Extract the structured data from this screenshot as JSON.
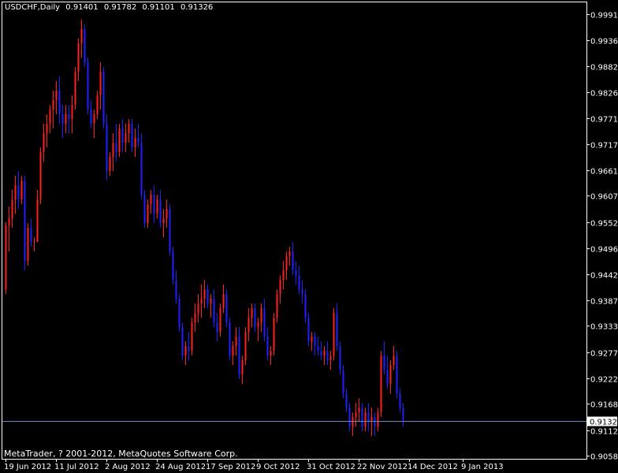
{
  "header": {
    "symbol": "USDCHF,Daily",
    "open": "0.91401",
    "high": "0.91782",
    "low": "0.91101",
    "close": "0.91326"
  },
  "footer": {
    "copyright": "MetaTrader, ? 2001-2012, MetaQuotes Software Corp."
  },
  "colors": {
    "background": "#000000",
    "foreground": "#ffffff",
    "bull": "#ff2020",
    "bear": "#2020ff",
    "price_line": "#6a86c8",
    "current_price_box": "#ffffff"
  },
  "chart_data": {
    "type": "candlestick",
    "ylim": [
      0.90585,
      0.99915
    ],
    "y_ticks": [
      "0.99915",
      "0.99360",
      "0.98820",
      "0.98265",
      "0.97710",
      "0.97170",
      "0.96615",
      "0.96075",
      "0.95520",
      "0.94965",
      "0.94425",
      "0.93870",
      "0.93330",
      "0.92775",
      "0.92220",
      "0.91680",
      "0.91125",
      "0.90585"
    ],
    "x_ticks": [
      {
        "label": "19 Jun 2012",
        "index": 0
      },
      {
        "label": "11 Jul 2012",
        "index": 16
      },
      {
        "label": "2 Aug 2012",
        "index": 32
      },
      {
        "label": "24 Aug 2012",
        "index": 48
      },
      {
        "label": "17 Sep 2012",
        "index": 64
      },
      {
        "label": "9 Oct 2012",
        "index": 80
      },
      {
        "label": "31 Oct 2012",
        "index": 96
      },
      {
        "label": "22 Nov 2012",
        "index": 112
      },
      {
        "label": "14 Dec 2012",
        "index": 128
      },
      {
        "label": "9 Jan 2013",
        "index": 145
      }
    ],
    "current_price": "0.91326",
    "candles": [
      [
        0.941,
        0.9552,
        0.94,
        0.9545
      ],
      [
        0.9545,
        0.9585,
        0.949,
        0.956
      ],
      [
        0.956,
        0.962,
        0.954,
        0.96
      ],
      [
        0.96,
        0.965,
        0.957,
        0.963
      ],
      [
        0.963,
        0.966,
        0.958,
        0.96
      ],
      [
        0.96,
        0.965,
        0.959,
        0.964
      ],
      [
        0.964,
        0.965,
        0.945,
        0.947
      ],
      [
        0.947,
        0.955,
        0.946,
        0.954
      ],
      [
        0.954,
        0.956,
        0.95,
        0.951
      ],
      [
        0.951,
        0.952,
        0.949,
        0.951
      ],
      [
        0.951,
        0.962,
        0.951,
        0.96
      ],
      [
        0.96,
        0.971,
        0.959,
        0.97
      ],
      [
        0.97,
        0.976,
        0.968,
        0.974
      ],
      [
        0.974,
        0.978,
        0.971,
        0.976
      ],
      [
        0.976,
        0.98,
        0.974,
        0.979
      ],
      [
        0.979,
        0.983,
        0.975,
        0.981
      ],
      [
        0.981,
        0.985,
        0.978,
        0.983
      ],
      [
        0.983,
        0.986,
        0.976,
        0.978
      ],
      [
        0.978,
        0.98,
        0.973,
        0.976
      ],
      [
        0.976,
        0.98,
        0.974,
        0.978
      ],
      [
        0.978,
        0.98,
        0.974,
        0.977
      ],
      [
        0.977,
        0.982,
        0.974,
        0.98
      ],
      [
        0.98,
        0.988,
        0.979,
        0.987
      ],
      [
        0.987,
        0.994,
        0.985,
        0.993
      ],
      [
        0.993,
        0.998,
        0.99,
        0.996
      ],
      [
        0.996,
        0.997,
        0.988,
        0.989
      ],
      [
        0.989,
        0.99,
        0.978,
        0.979
      ],
      [
        0.979,
        0.981,
        0.975,
        0.976
      ],
      [
        0.976,
        0.979,
        0.973,
        0.978
      ],
      [
        0.978,
        0.983,
        0.977,
        0.982
      ],
      [
        0.982,
        0.989,
        0.979,
        0.987
      ],
      [
        0.987,
        0.988,
        0.975,
        0.976
      ],
      [
        0.976,
        0.978,
        0.964,
        0.966
      ],
      [
        0.966,
        0.97,
        0.965,
        0.969
      ],
      [
        0.969,
        0.974,
        0.966,
        0.972
      ],
      [
        0.972,
        0.976,
        0.968,
        0.97
      ],
      [
        0.97,
        0.976,
        0.969,
        0.975
      ],
      [
        0.975,
        0.977,
        0.97,
        0.972
      ],
      [
        0.972,
        0.976,
        0.97,
        0.974
      ],
      [
        0.974,
        0.977,
        0.972,
        0.976
      ],
      [
        0.976,
        0.977,
        0.97,
        0.971
      ],
      [
        0.971,
        0.975,
        0.969,
        0.973
      ],
      [
        0.973,
        0.976,
        0.971,
        0.972
      ],
      [
        0.972,
        0.974,
        0.96,
        0.961
      ],
      [
        0.961,
        0.962,
        0.954,
        0.955
      ],
      [
        0.955,
        0.96,
        0.954,
        0.959
      ],
      [
        0.959,
        0.962,
        0.957,
        0.961
      ],
      [
        0.961,
        0.963,
        0.955,
        0.957
      ],
      [
        0.957,
        0.961,
        0.956,
        0.96
      ],
      [
        0.96,
        0.962,
        0.954,
        0.955
      ],
      [
        0.955,
        0.958,
        0.952,
        0.956
      ],
      [
        0.956,
        0.96,
        0.954,
        0.958
      ],
      [
        0.958,
        0.959,
        0.948,
        0.949
      ],
      [
        0.949,
        0.95,
        0.942,
        0.943
      ],
      [
        0.943,
        0.945,
        0.938,
        0.939
      ],
      [
        0.939,
        0.94,
        0.932,
        0.933
      ],
      [
        0.933,
        0.934,
        0.926,
        0.927
      ],
      [
        0.927,
        0.93,
        0.925,
        0.929
      ],
      [
        0.929,
        0.932,
        0.926,
        0.928
      ],
      [
        0.928,
        0.935,
        0.927,
        0.934
      ],
      [
        0.934,
        0.938,
        0.932,
        0.936
      ],
      [
        0.936,
        0.94,
        0.934,
        0.938
      ],
      [
        0.938,
        0.942,
        0.935,
        0.939
      ],
      [
        0.939,
        0.943,
        0.937,
        0.941
      ],
      [
        0.941,
        0.942,
        0.937,
        0.938
      ],
      [
        0.938,
        0.94,
        0.935,
        0.939
      ],
      [
        0.939,
        0.941,
        0.933,
        0.934
      ],
      [
        0.934,
        0.936,
        0.93,
        0.932
      ],
      [
        0.932,
        0.938,
        0.931,
        0.937
      ],
      [
        0.937,
        0.942,
        0.936,
        0.94
      ],
      [
        0.94,
        0.941,
        0.933,
        0.934
      ],
      [
        0.934,
        0.935,
        0.926,
        0.927
      ],
      [
        0.927,
        0.93,
        0.925,
        0.929
      ],
      [
        0.929,
        0.933,
        0.927,
        0.931
      ],
      [
        0.931,
        0.933,
        0.922,
        0.923
      ],
      [
        0.923,
        0.927,
        0.921,
        0.926
      ],
      [
        0.926,
        0.933,
        0.925,
        0.932
      ],
      [
        0.932,
        0.937,
        0.93,
        0.935
      ],
      [
        0.935,
        0.938,
        0.933,
        0.937
      ],
      [
        0.937,
        0.938,
        0.932,
        0.933
      ],
      [
        0.933,
        0.935,
        0.93,
        0.934
      ],
      [
        0.934,
        0.938,
        0.932,
        0.937
      ],
      [
        0.937,
        0.939,
        0.93,
        0.931
      ],
      [
        0.931,
        0.933,
        0.926,
        0.927
      ],
      [
        0.927,
        0.929,
        0.925,
        0.928
      ],
      [
        0.928,
        0.936,
        0.927,
        0.935
      ],
      [
        0.935,
        0.941,
        0.934,
        0.94
      ],
      [
        0.94,
        0.944,
        0.938,
        0.943
      ],
      [
        0.943,
        0.947,
        0.941,
        0.945
      ],
      [
        0.945,
        0.949,
        0.943,
        0.948
      ],
      [
        0.948,
        0.95,
        0.946,
        0.949
      ],
      [
        0.949,
        0.951,
        0.944,
        0.945
      ],
      [
        0.945,
        0.947,
        0.942,
        0.944
      ],
      [
        0.944,
        0.946,
        0.94,
        0.941
      ],
      [
        0.941,
        0.943,
        0.938,
        0.94
      ],
      [
        0.94,
        0.941,
        0.934,
        0.935
      ],
      [
        0.935,
        0.936,
        0.929,
        0.93
      ],
      [
        0.93,
        0.932,
        0.928,
        0.931
      ],
      [
        0.931,
        0.932,
        0.927,
        0.929
      ],
      [
        0.929,
        0.931,
        0.927,
        0.928
      ],
      [
        0.928,
        0.93,
        0.926,
        0.927
      ],
      [
        0.927,
        0.929,
        0.925,
        0.928
      ],
      [
        0.928,
        0.93,
        0.925,
        0.926
      ],
      [
        0.926,
        0.928,
        0.924,
        0.927
      ],
      [
        0.927,
        0.937,
        0.926,
        0.936
      ],
      [
        0.936,
        0.938,
        0.928,
        0.929
      ],
      [
        0.929,
        0.93,
        0.923,
        0.924
      ],
      [
        0.924,
        0.925,
        0.918,
        0.919
      ],
      [
        0.919,
        0.92,
        0.915,
        0.916
      ],
      [
        0.916,
        0.917,
        0.911,
        0.912
      ],
      [
        0.912,
        0.915,
        0.91,
        0.914
      ],
      [
        0.914,
        0.917,
        0.912,
        0.915
      ],
      [
        0.915,
        0.918,
        0.913,
        0.916
      ],
      [
        0.916,
        0.917,
        0.911,
        0.912
      ],
      [
        0.912,
        0.916,
        0.911,
        0.915
      ],
      [
        0.915,
        0.917,
        0.911,
        0.913
      ],
      [
        0.913,
        0.916,
        0.91,
        0.914
      ],
      [
        0.914,
        0.915,
        0.91,
        0.912
      ],
      [
        0.912,
        0.916,
        0.911,
        0.915
      ],
      [
        0.915,
        0.928,
        0.914,
        0.927
      ],
      [
        0.927,
        0.93,
        0.923,
        0.924
      ],
      [
        0.924,
        0.927,
        0.92,
        0.921
      ],
      [
        0.921,
        0.926,
        0.919,
        0.925
      ],
      [
        0.925,
        0.929,
        0.924,
        0.927
      ],
      [
        0.927,
        0.928,
        0.918,
        0.919
      ],
      [
        0.919,
        0.92,
        0.915,
        0.916
      ],
      [
        0.916,
        0.917,
        0.912,
        0.9133
      ]
    ]
  }
}
